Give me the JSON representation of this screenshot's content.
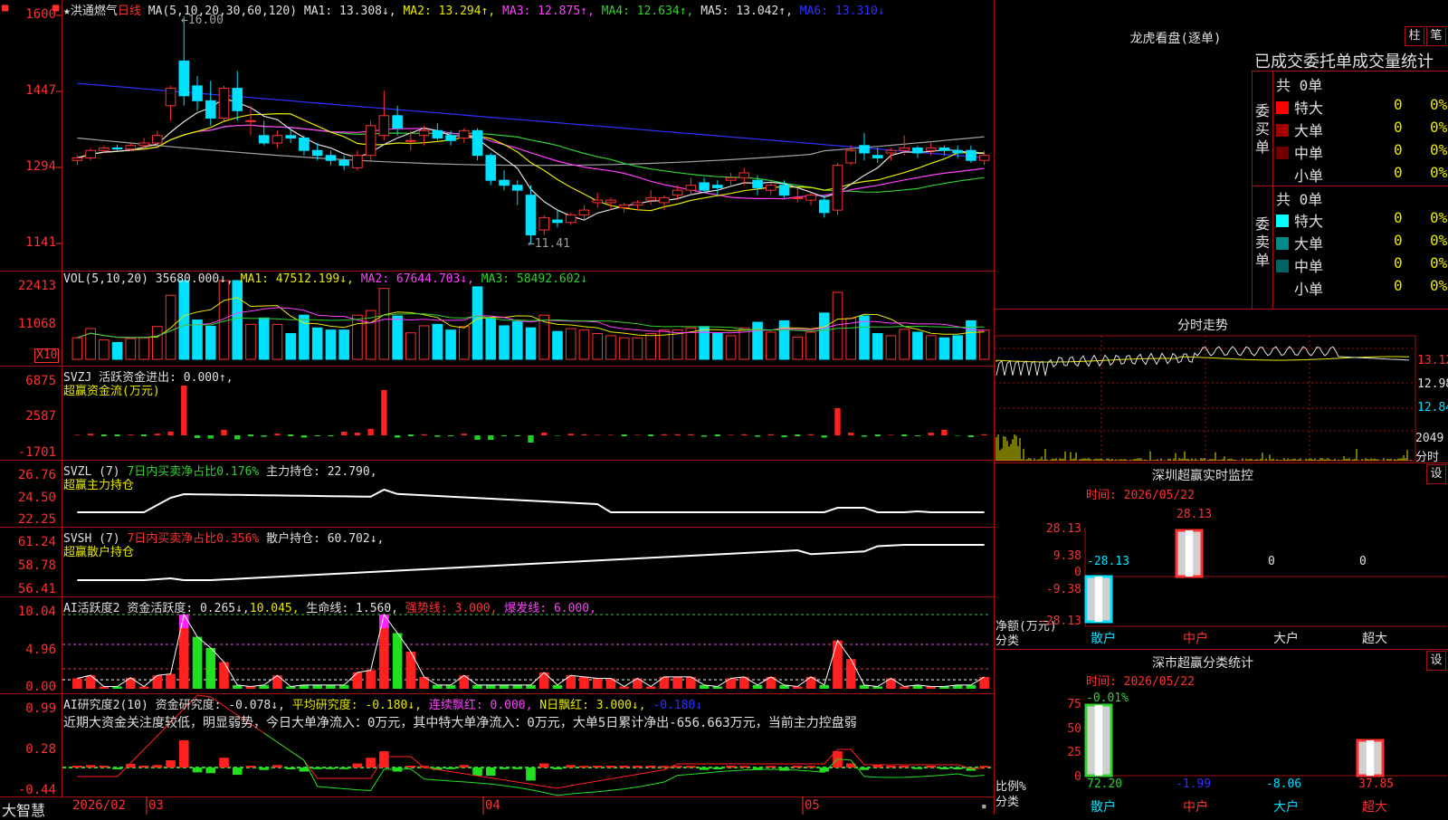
{
  "stock": {
    "marker": "★",
    "name": "洪通燃气",
    "period": "日线",
    "ma_label": "MA(5,10,20,30,60,120)",
    "ma1": "MA1: 13.308↓,",
    "ma2": "MA2: 13.294↑,",
    "ma3": "MA3: 12.875↑,",
    "ma4": "MA4: 12.634↑,",
    "ma5": "MA5: 13.042↑,",
    "ma6": "MA6: 13.310↓",
    "high_note": "←16.00",
    "low_note": "←11.41",
    "y_ticks": [
      "1600",
      "1447",
      "1294",
      "1141"
    ]
  },
  "vol": {
    "label": "VOL(5,10,20)",
    "value": "35680.000↓,",
    "ma1": "MA1: 47512.199↓,",
    "ma2": "MA2: 67644.703↓,",
    "ma3": "MA3: 58492.602↓",
    "y_ticks": [
      "22413",
      "11068"
    ],
    "unit": "X10"
  },
  "svzj": {
    "label": "SVZJ",
    "title": "活跃资金进出: 0.000↑,",
    "subtitle": "超赢资金流(万元)",
    "y_ticks": [
      "6875",
      "2587",
      "-1701"
    ]
  },
  "svzl": {
    "label": "SVZL (7)",
    "ratio": "7日内买卖净占比0.176%",
    "hold": "主力持仓: 22.790,",
    "subtitle": "超赢主力持仓",
    "y_ticks": [
      "26.76",
      "24.50",
      "22.25"
    ]
  },
  "svsh": {
    "label": "SVSH (7)",
    "ratio": "7日内买卖净占比0.356%",
    "hold": "散户持仓: 60.702↓,",
    "subtitle": "超赢散户持仓",
    "y_ticks": [
      "61.24",
      "58.78",
      "56.41"
    ]
  },
  "ai1": {
    "label": "AI活跃度2",
    "v1": "资金活跃度: 0.265↓,",
    "v2": "10.045,",
    "v3": "生命线: 1.560,",
    "v4": "强势线: 3.000,",
    "v5": "爆发线: 6.000,",
    "y_ticks": [
      "10.04",
      "4.96",
      "0.00"
    ]
  },
  "ai2": {
    "label": "AI研究度2(10)",
    "v1": "资金研究度: -0.078↓,",
    "v2": "平均研究度: -0.180↓,",
    "v3": "连续飘红: 0.000,",
    "v4": "N日飘红: 3.000↓,",
    "v5": "-0.180↓",
    "comment": "近期大资金关注度较低，明显弱势，今日大单净流入：0万元，其中特大单净流入：0万元，大单5日累计净出-656.663万元，当前主力控盘弱",
    "y_ticks": [
      "0.99",
      "0.28",
      "-0.44"
    ]
  },
  "xaxis": {
    "brand": "大智慧",
    "labels": [
      "2026/02",
      "03",
      "04",
      "05"
    ]
  },
  "right": {
    "dragon_title": "龙虎看盘(逐单)",
    "btn_bar": "柱",
    "btn_pen": "笔",
    "stat_title": "已成交委托单成交量统计",
    "buy": {
      "side_label": [
        "委",
        "买",
        "单"
      ],
      "total": "共 0单",
      "rows": [
        {
          "name": "特大",
          "v1": "0",
          "v2": "0%",
          "color": "#ff0000"
        },
        {
          "name": "大单",
          "v1": "0",
          "v2": "0%",
          "color": "#a00000"
        },
        {
          "name": "中单",
          "v1": "0",
          "v2": "0%",
          "color": "#700000"
        },
        {
          "name": "小单",
          "v1": "0",
          "v2": "0%",
          "color": "#000000"
        }
      ]
    },
    "sell": {
      "side_label": [
        "委",
        "卖",
        "单"
      ],
      "total": "共 0单",
      "rows": [
        {
          "name": "特大",
          "v1": "0",
          "v2": "0%",
          "color": "#00ffff"
        },
        {
          "name": "大单",
          "v1": "0",
          "v2": "0%",
          "color": "#008a8a"
        },
        {
          "name": "中单",
          "v1": "0",
          "v2": "0%",
          "color": "#006464"
        },
        {
          "name": "小单",
          "v1": "0",
          "v2": "0%",
          "color": "#000000"
        }
      ]
    },
    "intraday": {
      "title": "分时走势",
      "ticks": [
        "13.12",
        "12.98",
        "12.84"
      ],
      "vol_label": "2049",
      "vol_unit": "分时"
    },
    "monitor": {
      "title": "深圳超赢实时监控",
      "set": "设",
      "time": "时间: 2026/05/22",
      "y_ticks": [
        "28.13",
        "9.38",
        "0",
        "-9.38",
        "-28.13"
      ],
      "ylabel": "净额(万元)",
      "xlabel": "分类",
      "cats": [
        "散户",
        "中户",
        "大户",
        "超大"
      ],
      "values": [
        "-28.13",
        "28.13",
        "0",
        "0"
      ]
    },
    "classify": {
      "title": "深市超赢分类统计",
      "set": "设",
      "time": "时间: 2026/05/22",
      "y_ticks": [
        "75",
        "50",
        "25",
        "0"
      ],
      "ylabel": "比例%",
      "xlabel": "分类",
      "cats": [
        "散户",
        "中户",
        "大户",
        "超大"
      ],
      "top_note": "-0.01%",
      "values": [
        "72.20",
        "-1.99",
        "-8.06",
        "37.85"
      ]
    }
  },
  "chart_data": [
    {
      "type": "candlestick",
      "title": "洪通燃气 日线",
      "ylim": [
        11.41,
        16.0
      ],
      "note": "approximate daily OHLC read from chart, 2026/02 - 2026/05",
      "ohlc": [
        [
          13.1,
          13.2,
          13.0,
          13.15
        ],
        [
          13.15,
          13.35,
          13.1,
          13.3
        ],
        [
          13.3,
          13.4,
          13.25,
          13.35
        ],
        [
          13.35,
          13.42,
          13.28,
          13.33
        ],
        [
          13.33,
          13.45,
          13.3,
          13.4
        ],
        [
          13.4,
          13.55,
          13.35,
          13.45
        ],
        [
          13.45,
          13.7,
          13.4,
          13.6
        ],
        [
          14.2,
          14.6,
          13.9,
          14.55
        ],
        [
          15.1,
          16.0,
          14.2,
          14.4
        ],
        [
          14.6,
          14.8,
          14.1,
          14.3
        ],
        [
          14.3,
          14.7,
          13.8,
          13.95
        ],
        [
          13.95,
          14.6,
          13.9,
          14.55
        ],
        [
          14.55,
          14.9,
          13.9,
          14.1
        ],
        [
          13.9,
          14.2,
          13.6,
          13.9
        ],
        [
          13.6,
          13.9,
          13.4,
          13.45
        ],
        [
          13.45,
          13.7,
          13.35,
          13.6
        ],
        [
          13.6,
          13.75,
          13.45,
          13.55
        ],
        [
          13.55,
          13.6,
          13.2,
          13.3
        ],
        [
          13.3,
          13.45,
          13.1,
          13.2
        ],
        [
          13.2,
          13.3,
          13.0,
          13.1
        ],
        [
          13.1,
          13.2,
          12.9,
          13.0
        ],
        [
          12.95,
          13.3,
          12.9,
          13.2
        ],
        [
          13.2,
          13.9,
          13.1,
          13.8
        ],
        [
          13.6,
          14.5,
          13.5,
          14.0
        ],
        [
          14.0,
          14.2,
          13.6,
          13.75
        ],
        [
          13.5,
          13.7,
          13.3,
          13.5
        ],
        [
          13.6,
          13.8,
          13.4,
          13.7
        ],
        [
          13.7,
          13.85,
          13.5,
          13.55
        ],
        [
          13.6,
          13.7,
          13.4,
          13.5
        ],
        [
          13.55,
          13.75,
          13.45,
          13.7
        ],
        [
          13.7,
          13.75,
          13.1,
          13.2
        ],
        [
          13.2,
          13.25,
          12.6,
          12.7
        ],
        [
          12.7,
          12.9,
          12.5,
          12.6
        ],
        [
          12.6,
          12.7,
          12.2,
          12.5
        ],
        [
          12.4,
          12.6,
          11.41,
          11.6
        ],
        [
          11.7,
          12.0,
          11.6,
          11.95
        ],
        [
          11.9,
          12.1,
          11.75,
          11.85
        ],
        [
          11.85,
          12.05,
          11.8,
          12.0
        ],
        [
          12.0,
          12.2,
          11.9,
          12.1
        ],
        [
          12.25,
          12.45,
          12.15,
          12.3
        ],
        [
          12.25,
          12.35,
          12.1,
          12.3
        ],
        [
          12.15,
          12.25,
          12.05,
          12.2
        ],
        [
          12.2,
          12.3,
          12.1,
          12.25
        ],
        [
          12.3,
          12.5,
          12.2,
          12.35
        ],
        [
          12.25,
          12.4,
          12.1,
          12.35
        ],
        [
          12.4,
          12.6,
          12.3,
          12.5
        ],
        [
          12.5,
          12.75,
          12.4,
          12.6
        ],
        [
          12.65,
          12.75,
          12.45,
          12.5
        ],
        [
          12.6,
          12.7,
          12.4,
          12.55
        ],
        [
          12.7,
          12.85,
          12.6,
          12.75
        ],
        [
          12.75,
          12.95,
          12.6,
          12.85
        ],
        [
          12.7,
          12.8,
          12.4,
          12.55
        ],
        [
          12.5,
          12.65,
          12.4,
          12.6
        ],
        [
          12.6,
          12.7,
          12.35,
          12.4
        ],
        [
          12.35,
          12.55,
          12.25,
          12.35
        ],
        [
          12.3,
          12.45,
          12.2,
          12.4
        ],
        [
          12.3,
          12.4,
          11.95,
          12.05
        ],
        [
          12.1,
          13.05,
          12.0,
          13.0
        ],
        [
          13.05,
          13.4,
          13.0,
          13.3
        ],
        [
          13.4,
          13.65,
          13.1,
          13.25
        ],
        [
          13.2,
          13.35,
          13.05,
          13.15
        ],
        [
          13.25,
          13.35,
          13.1,
          13.3
        ],
        [
          13.3,
          13.6,
          13.2,
          13.35
        ],
        [
          13.35,
          13.4,
          13.15,
          13.25
        ],
        [
          13.3,
          13.45,
          13.2,
          13.35
        ],
        [
          13.35,
          13.4,
          13.2,
          13.3
        ],
        [
          13.3,
          13.4,
          13.15,
          13.25
        ],
        [
          13.3,
          13.4,
          13.05,
          13.1
        ],
        [
          13.1,
          13.3,
          13.0,
          13.2
        ]
      ]
    }
  ]
}
